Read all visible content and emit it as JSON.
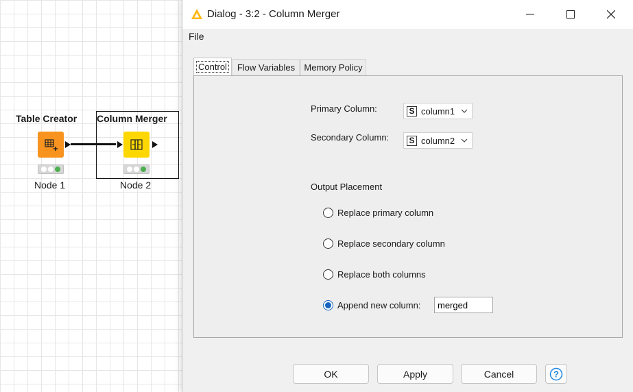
{
  "workflow": {
    "nodes": [
      {
        "title": "Table Creator",
        "label": "Node 1",
        "icon": "table-grid-icon",
        "color": "#f7931e"
      },
      {
        "title": "Column Merger",
        "label": "Node 2",
        "icon": "column-merge-icon",
        "color": "#ffd700"
      }
    ]
  },
  "dialog": {
    "title": "Dialog - 3:2 - Column Merger",
    "menu": {
      "file": "File"
    },
    "tabs": [
      {
        "label": "Control",
        "active": true
      },
      {
        "label": "Flow Variables",
        "active": false
      },
      {
        "label": "Memory Policy",
        "active": false
      }
    ],
    "primary_column": {
      "label": "Primary Column:",
      "type_badge": "S",
      "value": "column1"
    },
    "secondary_column": {
      "label": "Secondary Column:",
      "type_badge": "S",
      "value": "column2"
    },
    "output_placement": {
      "label": "Output Placement",
      "options": [
        {
          "label": "Replace primary column",
          "selected": false
        },
        {
          "label": "Replace secondary column",
          "selected": false
        },
        {
          "label": "Replace both columns",
          "selected": false
        },
        {
          "label": "Append new column:",
          "selected": true
        }
      ],
      "new_column_name": "merged"
    },
    "buttons": {
      "ok": "OK",
      "apply": "Apply",
      "cancel": "Cancel",
      "help": "help-icon"
    }
  },
  "colors": {
    "accent": "#1565c0",
    "table_creator": "#f7931e",
    "column_merger": "#ffd700"
  }
}
